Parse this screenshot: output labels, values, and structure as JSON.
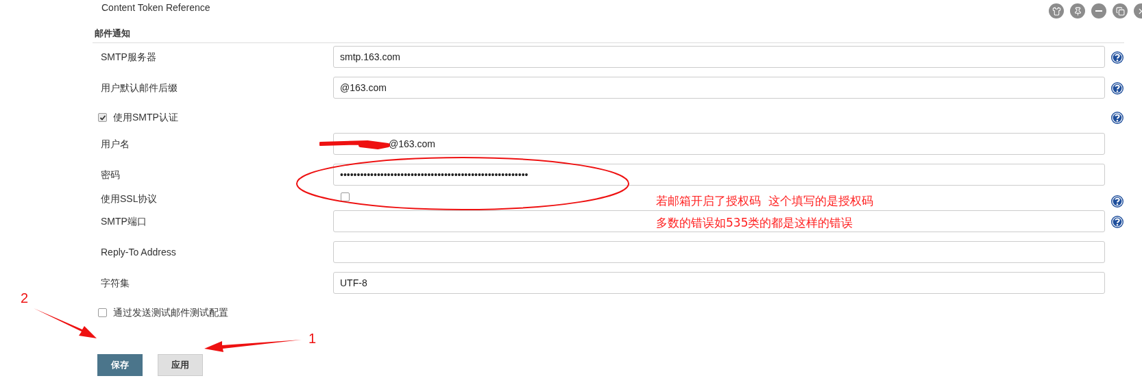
{
  "content_token_label": "Content Token Reference",
  "section_title": "邮件通知",
  "rows": [
    {
      "kind": "field",
      "label": "SMTP服务器",
      "value": "smtp.163.com",
      "help": true
    },
    {
      "kind": "field",
      "label": "用户默认邮件后缀",
      "value": "@163.com",
      "help": true
    },
    {
      "kind": "checkbox",
      "label": "使用SMTP认证",
      "checked": true,
      "help": true
    },
    {
      "kind": "field",
      "label": "用户名",
      "value": "@163.com",
      "help": false,
      "redacted": true
    },
    {
      "kind": "field",
      "label": "密码",
      "value": "••••••••••••••••••••••••••••••••••••••••••••••••••••••••",
      "help": false
    },
    {
      "kind": "labeled_checkbox",
      "label": "使用SSL协议",
      "checked": false,
      "help": true
    },
    {
      "kind": "field",
      "label": "SMTP端口",
      "value": "",
      "help": true
    },
    {
      "kind": "field",
      "label": "Reply-To Address",
      "value": "",
      "help": false
    },
    {
      "kind": "field",
      "label": "字符集",
      "value": "UTF-8",
      "help": false
    },
    {
      "kind": "checkbox",
      "label": "通过发送测试邮件测试配置",
      "checked": false,
      "help": false
    }
  ],
  "buttons": [
    {
      "label": "保存",
      "primary": true
    },
    {
      "label": "应用",
      "primary": false
    }
  ],
  "annotation": {
    "note_lines": [
      "若邮箱开启了授权码  这个填写的是授权码",
      "多数的错误如535类的都是这样的错误"
    ],
    "markers": [
      "2",
      "1"
    ]
  }
}
